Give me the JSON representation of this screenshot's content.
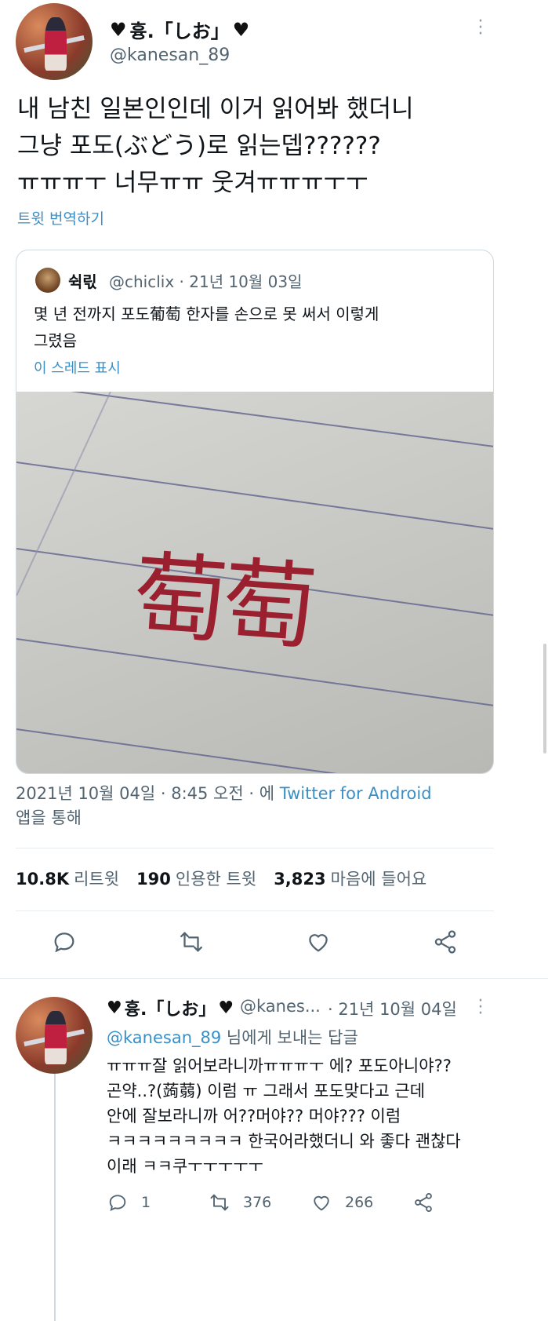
{
  "main_tweet": {
    "display_name": "흉.「しお」",
    "handle": "@kanesan_89",
    "text": "내 남친 일본인인데 이거 읽어봐 했더니\n그냥 포도(ぶどう)로 읽는뎁??????\nㅠㅠㅠㅜ 너무ㅠㅠ 웃겨ㅠㅠㅠㅜㅜ",
    "translate_label": "트윗 번역하기",
    "timestamp": "2021년 10월 04일 · 8:45 오전 · 에",
    "source_link": "Twitter for Android",
    "timestamp_suffix": "앱을 통해",
    "stats": [
      {
        "value": "10.8K",
        "label": "리트윗"
      },
      {
        "value": "190",
        "label": "인용한 트윗"
      },
      {
        "value": "3,823",
        "label": "마음에 들어요"
      }
    ],
    "actions": [
      "reply-icon",
      "retweet-icon",
      "like-icon",
      "share-icon"
    ]
  },
  "quote": {
    "display_name": "쉭릯",
    "handle_date": "@chiclix · 21년 10월 03일",
    "text": "몇 년 전까지 포도葡萄 한자를 손으로 못 써서 이렇게\n그렸음",
    "show_thread": "이 스레드 표시",
    "image_characters": "萄萄"
  },
  "reply": {
    "display_name": "흉.「しお」",
    "handle": "@kanes...",
    "date": "· 21년 10월 04일",
    "replying_to_link": "@kanesan_89",
    "replying_to_suffix": " 님에게 보내는 답글",
    "text": "ㅠㅠㅠ잘 읽어보라니까ㅠㅠㅠㅜ 에? 포도아니야??\n곤약..?(蒟蒻) 이럼 ㅠ 그래서 포도맞다고 근데\n안에 잘보라니까 어??머야?? 머야??? 이럼\nㅋㅋㅋㅋㅋㅋㅋㅋㅋ 한국어라했더니 와 좋다 괜찮다\n이래 ㅋㅋ쿠ㅜㅜㅜㅜㅜ",
    "reply_count": "1",
    "retweet_count": "376",
    "like_count": "266"
  },
  "colors": {
    "link": "#3a8fc7",
    "secondary": "#536471",
    "divider": "#e6ecf0"
  }
}
